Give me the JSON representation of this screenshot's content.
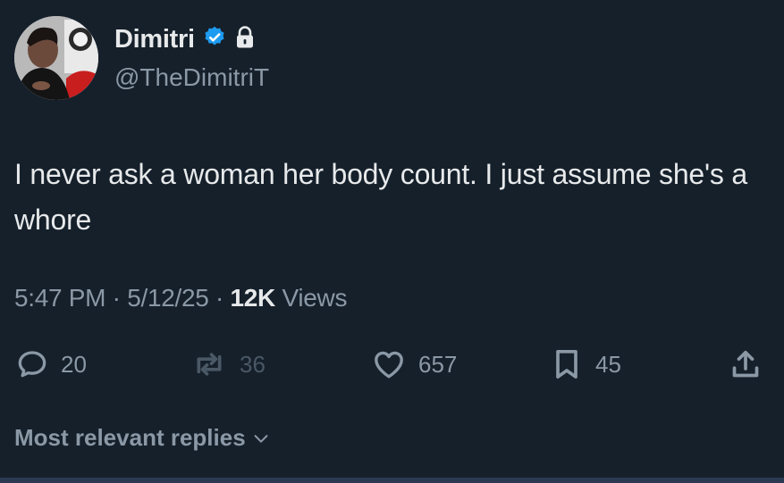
{
  "author": {
    "name": "Dimitri",
    "handle": "@TheDimitriT",
    "verified_badge_icon": "verified-badge-icon",
    "protected_icon": "lock-icon"
  },
  "tweet": {
    "text": "I never ask a woman her body count. I just assume she's a whore",
    "time": "5:47 PM",
    "date": "5/12/25",
    "separator": "·",
    "views_count": "12K",
    "views_label": "Views"
  },
  "actions": {
    "replies": "20",
    "reposts": "36",
    "likes": "657",
    "bookmarks": "45"
  },
  "replies_sort": {
    "label": "Most relevant replies"
  },
  "colors": {
    "background": "#15202b",
    "text_primary": "#e7e9ea",
    "text_secondary": "#8b98a5",
    "verified_blue": "#1d9bf0"
  }
}
